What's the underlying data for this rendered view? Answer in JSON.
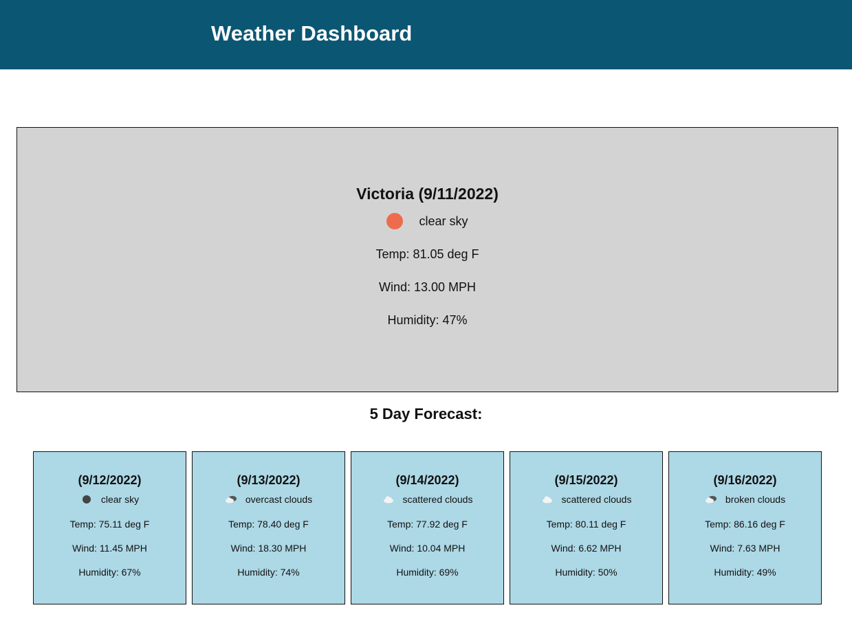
{
  "header": {
    "title": "Weather Dashboard"
  },
  "current": {
    "city_date": "Victoria (9/11/2022)",
    "icon": "sun-icon",
    "description": "clear sky",
    "temp": "Temp: 81.05 deg F",
    "wind": "Wind: 13.00 MPH",
    "humidity": "Humidity: 47%"
  },
  "forecast": {
    "title": "5 Day Forecast:",
    "days": [
      {
        "date": "(9/12/2022)",
        "icon": "moon-icon",
        "description": "clear sky",
        "temp": "Temp: 75.11 deg F",
        "wind": "Wind: 11.45 MPH",
        "humidity": "Humidity: 67%"
      },
      {
        "date": "(9/13/2022)",
        "icon": "overcast-clouds-icon",
        "description": "overcast clouds",
        "temp": "Temp: 78.40 deg F",
        "wind": "Wind: 18.30 MPH",
        "humidity": "Humidity: 74%"
      },
      {
        "date": "(9/14/2022)",
        "icon": "scattered-clouds-icon",
        "description": "scattered clouds",
        "temp": "Temp: 77.92 deg F",
        "wind": "Wind: 10.04 MPH",
        "humidity": "Humidity: 69%"
      },
      {
        "date": "(9/15/2022)",
        "icon": "scattered-clouds-icon",
        "description": "scattered clouds",
        "temp": "Temp: 80.11 deg F",
        "wind": "Wind: 6.62 MPH",
        "humidity": "Humidity: 50%"
      },
      {
        "date": "(9/16/2022)",
        "icon": "broken-clouds-icon",
        "description": "broken clouds",
        "temp": "Temp: 86.16 deg F",
        "wind": "Wind: 7.63 MPH",
        "humidity": "Humidity: 49%"
      }
    ]
  },
  "colors": {
    "header_bg": "#0b5673",
    "current_bg": "#d3d3d3",
    "card_bg": "#add8e6",
    "sun": "#ee6c4d",
    "moon": "#444444"
  }
}
